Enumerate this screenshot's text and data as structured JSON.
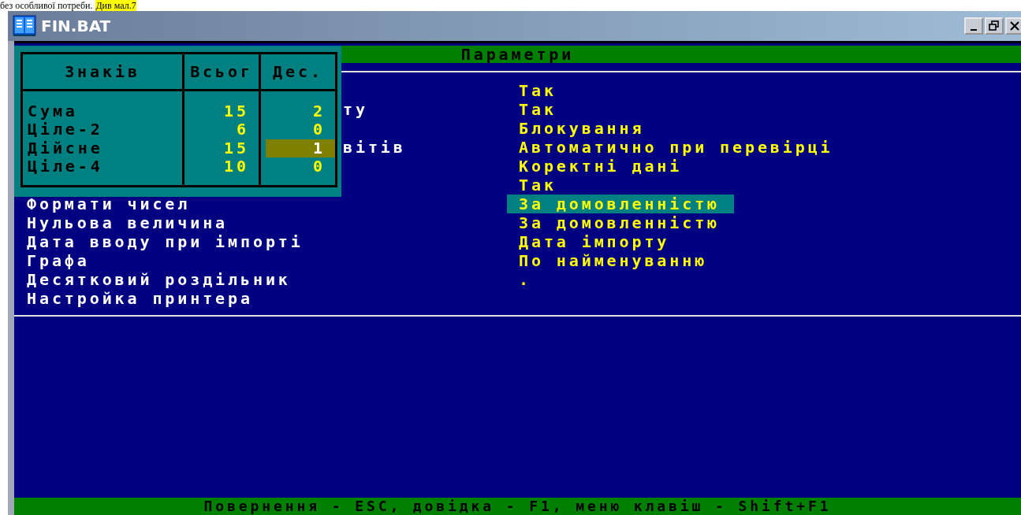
{
  "caption": {
    "text": "без особливої потреби.",
    "highlight": "Див мал.7"
  },
  "window": {
    "title": "FIN.BAT"
  },
  "header": "Параметри",
  "rows": [
    {
      "value": "Так",
      "selected": false
    },
    {
      "label": "ту",
      "obscured": true,
      "value": "Так",
      "selected": false
    },
    {
      "value": "Блокування",
      "selected": false
    },
    {
      "label": "вітів",
      "obscured": true,
      "value": "Автоматично при перевірці",
      "selected": false
    },
    {
      "value": "Коректні дані",
      "selected": false
    },
    {
      "value": "Так",
      "selected": false
    },
    {
      "label": "Формати чисел",
      "value": "За домовленністю",
      "selected": true
    },
    {
      "label": "Нульова величина",
      "value": "За домовленністю",
      "selected": false
    },
    {
      "label": "Дата вводу при імпорті",
      "value": "Дата імпорту",
      "selected": false
    },
    {
      "label": "Графа",
      "value": "По найменуванню",
      "selected": false
    },
    {
      "label": "Десятковий роздільник",
      "value": ".",
      "selected": false
    },
    {
      "label": "Настройка принтера"
    }
  ],
  "popup": {
    "columns": [
      "Знаків",
      "Всьог",
      "Дес."
    ],
    "rows": [
      {
        "name": "Сума",
        "total": "15",
        "decimals": "2",
        "selected": false
      },
      {
        "name": "Ціле-2",
        "total": "6",
        "decimals": "0",
        "selected": false
      },
      {
        "name": "Дійсне",
        "total": "15",
        "decimals": "1",
        "selected": true
      },
      {
        "name": "Ціле-4",
        "total": "10",
        "decimals": "0",
        "selected": false
      }
    ]
  },
  "status_bar": "Повернення - ESC, довідка - F1, меню клавіш - Shift+F1"
}
